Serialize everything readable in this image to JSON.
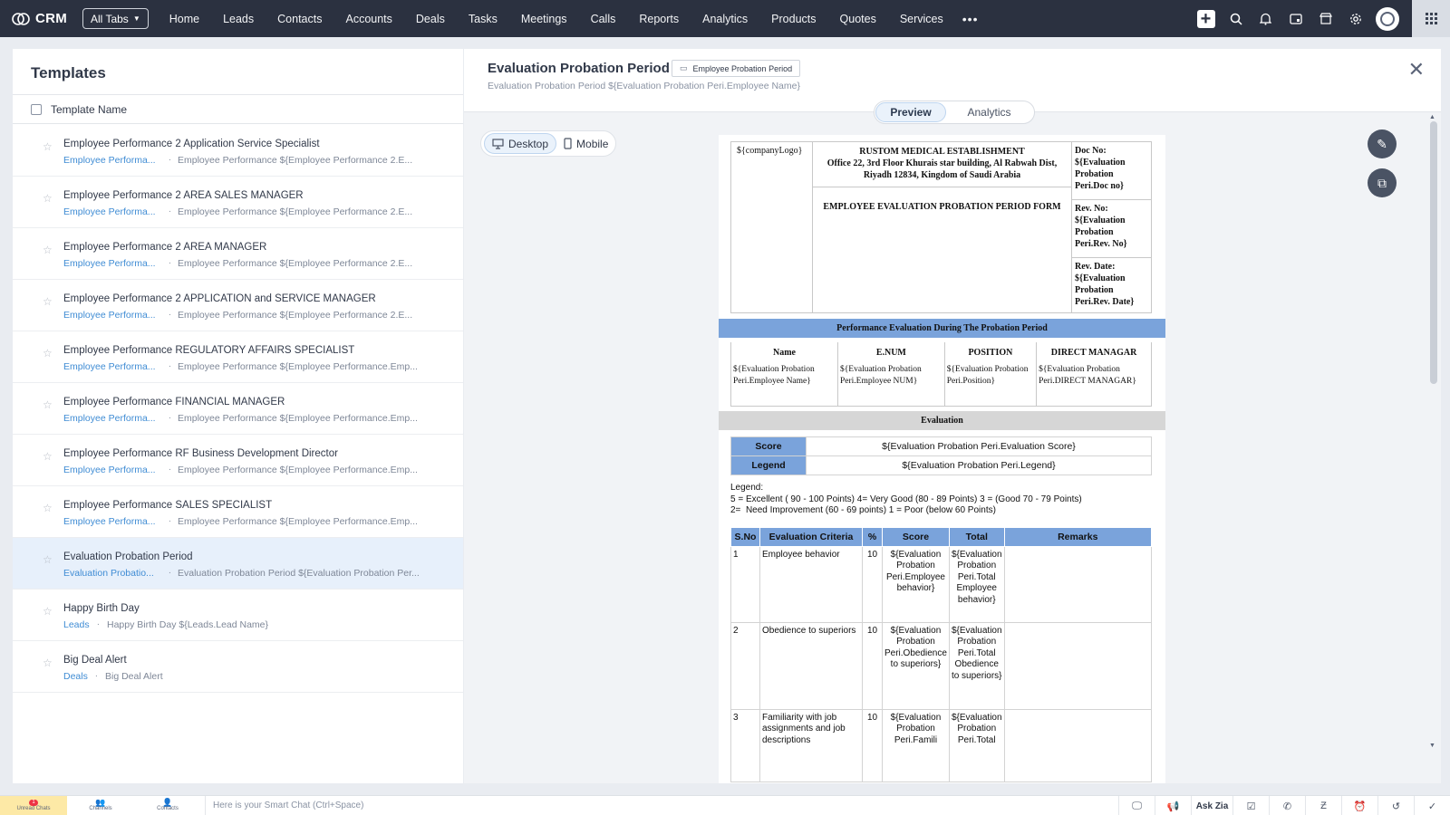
{
  "app": {
    "name": "CRM",
    "all_tabs": "All Tabs"
  },
  "nav": {
    "links": [
      "Home",
      "Leads",
      "Contacts",
      "Accounts",
      "Deals",
      "Tasks",
      "Meetings",
      "Calls",
      "Reports",
      "Analytics",
      "Products",
      "Quotes",
      "Services"
    ],
    "more": "•••"
  },
  "templates": {
    "title": "Templates",
    "column_header": "Template Name",
    "items": [
      {
        "name": "Employee Performance 2 Application Service Specialist",
        "module": "Employee Performa...",
        "subject": "Employee Performance ${Employee Performance 2.E..."
      },
      {
        "name": "Employee Performance 2 AREA SALES MANAGER",
        "module": "Employee Performa...",
        "subject": "Employee Performance ${Employee Performance 2.E..."
      },
      {
        "name": "Employee Performance 2 AREA MANAGER",
        "module": "Employee Performa...",
        "subject": "Employee Performance ${Employee Performance 2.E..."
      },
      {
        "name": "Employee Performance 2 APPLICATION and SERVICE MANAGER",
        "module": "Employee Performa...",
        "subject": "Employee Performance ${Employee Performance 2.E..."
      },
      {
        "name": "Employee Performance REGULATORY AFFAIRS SPECIALIST",
        "module": "Employee Performa...",
        "subject": "Employee Performance ${Employee Performance.Emp..."
      },
      {
        "name": "Employee Performance FINANCIAL MANAGER",
        "module": "Employee Performa...",
        "subject": "Employee Performance ${Employee Performance.Emp..."
      },
      {
        "name": "Employee Performance RF Business Development Director",
        "module": "Employee Performa...",
        "subject": "Employee Performance ${Employee Performance.Emp..."
      },
      {
        "name": "Employee Performance SALES SPECIALIST",
        "module": "Employee Performa...",
        "subject": "Employee Performance ${Employee Performance.Emp..."
      },
      {
        "name": "Evaluation Probation Period",
        "module": "Evaluation Probatio...",
        "subject": "Evaluation Probation Period ${Evaluation Probation Per..."
      },
      {
        "name": "Happy Birth Day",
        "module": "Leads",
        "subject": "Happy Birth Day ${Leads.Lead Name}"
      },
      {
        "name": "Big Deal Alert",
        "module": "Deals",
        "subject": "Big Deal Alert"
      }
    ]
  },
  "preview": {
    "title": "Evaluation Probation Period",
    "folder": "Employee Probation Period",
    "subject": "Evaluation Probation Period ${Evaluation Probation Peri.Employee Name}",
    "tabs": [
      "Preview",
      "Analytics"
    ],
    "devices": [
      "Desktop",
      "Mobile"
    ]
  },
  "document": {
    "logo": "${companyLogo}",
    "company_line1": "RUSTOM MEDICAL ESTABLISHMENT",
    "company_line2": "Office 22, 3rd Floor Khurais star building, Al Rabwah Dist, Riyadh 12834, Kingdom of Saudi Arabia",
    "form_title": "EMPLOYEE EVALUATION PROBATION PERIOD FORM",
    "doc_no": "Doc No: ${Evaluation Probation Peri.Doc no}",
    "rev_no": "Rev. No: ${Evaluation Probation Peri.Rev. No}",
    "rev_date": "Rev. Date: ${Evaluation Probation Peri.Rev. Date}",
    "section1": "Performance Evaluation During The Probation Period",
    "emp_headers": [
      "Name",
      "E.NUM",
      "POSITION",
      "DIRECT MANAGAR"
    ],
    "emp_values": [
      "${Evaluation Probation Peri.Employee Name}",
      "${Evaluation Probation Peri.Employee NUM}",
      "${Evaluation Probation Peri.Position}",
      "${Evaluation Probation Peri.DIRECT MANAGAR}"
    ],
    "section2": "Evaluation",
    "score_label": "Score",
    "score_value": "${Evaluation Probation Peri.Evaluation Score}",
    "legend_label": "Legend",
    "legend_value": "${Evaluation Probation Peri.Legend}",
    "legend_title": "Legend:",
    "legend_line1": "5 = Excellent ( 90 - 100 Points) 4= Very Good (80 - 89 Points) 3 = (Good 70 - 79 Points)",
    "legend_line2": "2=  Need Improvement (60 - 69 points) 1 = Poor (below 60 Points)",
    "eval_headers": [
      "S.No",
      "Evaluation Criteria",
      "%",
      "Score",
      "Total",
      "Remarks"
    ],
    "eval_rows": [
      {
        "sno": "1",
        "criteria": "Employee behavior",
        "pct": "10",
        "score": "${Evaluation Probation Peri.Employee behavior}",
        "total": "${Evaluation Probation Peri.Total Employee behavior}"
      },
      {
        "sno": "2",
        "criteria": "Obedience to superiors",
        "pct": "10",
        "score": "${Evaluation Probation Peri.Obedience to superiors}",
        "total": "${Evaluation Probation Peri.Total Obedience to superiors}"
      },
      {
        "sno": "3",
        "criteria": "Familiarity with job assignments and job descriptions",
        "pct": "10",
        "score": "${Evaluation Probation Peri.Famili",
        "total": "${Evaluation Probation Peri.Total"
      }
    ]
  },
  "bottombar": {
    "unread_chats": "Unread Chats",
    "unread_count": "1",
    "channels": "Channels",
    "contacts": "Contacts",
    "smart_chat": "Here is your Smart Chat (Ctrl+Space)",
    "ask_zia": "Ask Zia"
  },
  "colors": {
    "nav_bg": "#2b3140",
    "doc_band_blue": "#7aa3db",
    "link_blue": "#3f8cd4",
    "selected_row": "#e7f0fb"
  }
}
